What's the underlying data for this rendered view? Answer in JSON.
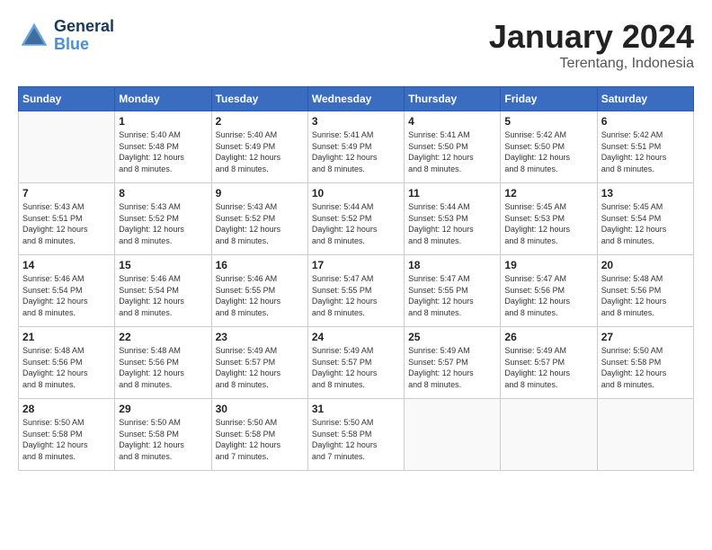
{
  "header": {
    "logo_line1": "General",
    "logo_line2": "Blue",
    "month": "January 2024",
    "location": "Terentang, Indonesia"
  },
  "weekdays": [
    "Sunday",
    "Monday",
    "Tuesday",
    "Wednesday",
    "Thursday",
    "Friday",
    "Saturday"
  ],
  "weeks": [
    [
      {
        "day": "",
        "info": ""
      },
      {
        "day": "1",
        "info": "Sunrise: 5:40 AM\nSunset: 5:48 PM\nDaylight: 12 hours\nand 8 minutes."
      },
      {
        "day": "2",
        "info": "Sunrise: 5:40 AM\nSunset: 5:49 PM\nDaylight: 12 hours\nand 8 minutes."
      },
      {
        "day": "3",
        "info": "Sunrise: 5:41 AM\nSunset: 5:49 PM\nDaylight: 12 hours\nand 8 minutes."
      },
      {
        "day": "4",
        "info": "Sunrise: 5:41 AM\nSunset: 5:50 PM\nDaylight: 12 hours\nand 8 minutes."
      },
      {
        "day": "5",
        "info": "Sunrise: 5:42 AM\nSunset: 5:50 PM\nDaylight: 12 hours\nand 8 minutes."
      },
      {
        "day": "6",
        "info": "Sunrise: 5:42 AM\nSunset: 5:51 PM\nDaylight: 12 hours\nand 8 minutes."
      }
    ],
    [
      {
        "day": "7",
        "info": "Sunrise: 5:43 AM\nSunset: 5:51 PM\nDaylight: 12 hours\nand 8 minutes."
      },
      {
        "day": "8",
        "info": "Sunrise: 5:43 AM\nSunset: 5:52 PM\nDaylight: 12 hours\nand 8 minutes."
      },
      {
        "day": "9",
        "info": "Sunrise: 5:43 AM\nSunset: 5:52 PM\nDaylight: 12 hours\nand 8 minutes."
      },
      {
        "day": "10",
        "info": "Sunrise: 5:44 AM\nSunset: 5:52 PM\nDaylight: 12 hours\nand 8 minutes."
      },
      {
        "day": "11",
        "info": "Sunrise: 5:44 AM\nSunset: 5:53 PM\nDaylight: 12 hours\nand 8 minutes."
      },
      {
        "day": "12",
        "info": "Sunrise: 5:45 AM\nSunset: 5:53 PM\nDaylight: 12 hours\nand 8 minutes."
      },
      {
        "day": "13",
        "info": "Sunrise: 5:45 AM\nSunset: 5:54 PM\nDaylight: 12 hours\nand 8 minutes."
      }
    ],
    [
      {
        "day": "14",
        "info": "Sunrise: 5:46 AM\nSunset: 5:54 PM\nDaylight: 12 hours\nand 8 minutes."
      },
      {
        "day": "15",
        "info": "Sunrise: 5:46 AM\nSunset: 5:54 PM\nDaylight: 12 hours\nand 8 minutes."
      },
      {
        "day": "16",
        "info": "Sunrise: 5:46 AM\nSunset: 5:55 PM\nDaylight: 12 hours\nand 8 minutes."
      },
      {
        "day": "17",
        "info": "Sunrise: 5:47 AM\nSunset: 5:55 PM\nDaylight: 12 hours\nand 8 minutes."
      },
      {
        "day": "18",
        "info": "Sunrise: 5:47 AM\nSunset: 5:55 PM\nDaylight: 12 hours\nand 8 minutes."
      },
      {
        "day": "19",
        "info": "Sunrise: 5:47 AM\nSunset: 5:56 PM\nDaylight: 12 hours\nand 8 minutes."
      },
      {
        "day": "20",
        "info": "Sunrise: 5:48 AM\nSunset: 5:56 PM\nDaylight: 12 hours\nand 8 minutes."
      }
    ],
    [
      {
        "day": "21",
        "info": "Sunrise: 5:48 AM\nSunset: 5:56 PM\nDaylight: 12 hours\nand 8 minutes."
      },
      {
        "day": "22",
        "info": "Sunrise: 5:48 AM\nSunset: 5:56 PM\nDaylight: 12 hours\nand 8 minutes."
      },
      {
        "day": "23",
        "info": "Sunrise: 5:49 AM\nSunset: 5:57 PM\nDaylight: 12 hours\nand 8 minutes."
      },
      {
        "day": "24",
        "info": "Sunrise: 5:49 AM\nSunset: 5:57 PM\nDaylight: 12 hours\nand 8 minutes."
      },
      {
        "day": "25",
        "info": "Sunrise: 5:49 AM\nSunset: 5:57 PM\nDaylight: 12 hours\nand 8 minutes."
      },
      {
        "day": "26",
        "info": "Sunrise: 5:49 AM\nSunset: 5:57 PM\nDaylight: 12 hours\nand 8 minutes."
      },
      {
        "day": "27",
        "info": "Sunrise: 5:50 AM\nSunset: 5:58 PM\nDaylight: 12 hours\nand 8 minutes."
      }
    ],
    [
      {
        "day": "28",
        "info": "Sunrise: 5:50 AM\nSunset: 5:58 PM\nDaylight: 12 hours\nand 8 minutes."
      },
      {
        "day": "29",
        "info": "Sunrise: 5:50 AM\nSunset: 5:58 PM\nDaylight: 12 hours\nand 8 minutes."
      },
      {
        "day": "30",
        "info": "Sunrise: 5:50 AM\nSunset: 5:58 PM\nDaylight: 12 hours\nand 7 minutes."
      },
      {
        "day": "31",
        "info": "Sunrise: 5:50 AM\nSunset: 5:58 PM\nDaylight: 12 hours\nand 7 minutes."
      },
      {
        "day": "",
        "info": ""
      },
      {
        "day": "",
        "info": ""
      },
      {
        "day": "",
        "info": ""
      }
    ]
  ]
}
